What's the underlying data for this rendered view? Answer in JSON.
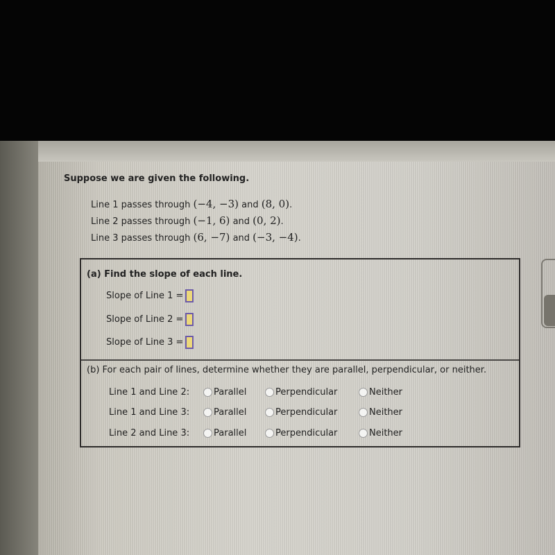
{
  "problem": {
    "intro": "Suppose we are given the following.",
    "lines": [
      {
        "label": "Line 1 passes through",
        "p1": "(−4, −3)",
        "and": "and",
        "p2": "(8, 0)",
        "end": "."
      },
      {
        "label": "Line 2 passes through",
        "p1": "(−1, 6)",
        "and": "and",
        "p2": "(0, 2)",
        "end": "."
      },
      {
        "label": "Line 3 passes through",
        "p1": "(6, −7)",
        "and": "and",
        "p2": "(−3, −4)",
        "end": "."
      }
    ]
  },
  "part_a": {
    "title": "(a) Find the slope of each line.",
    "rows": [
      {
        "label": "Slope of Line 1",
        "eq": "=",
        "value": ""
      },
      {
        "label": "Slope of Line 2",
        "eq": "=",
        "value": ""
      },
      {
        "label": "Slope of Line 3",
        "eq": "=",
        "value": ""
      }
    ]
  },
  "part_b": {
    "title": "(b) For each pair of lines, determine whether they are parallel, perpendicular, or neither.",
    "options": [
      "Parallel",
      "Perpendicular",
      "Neither"
    ],
    "rows": [
      {
        "label": "Line 1 and Line 2:",
        "selected": null
      },
      {
        "label": "Line 1 and Line 3:",
        "selected": null
      },
      {
        "label": "Line 2 and Line 3:",
        "selected": null
      }
    ]
  }
}
